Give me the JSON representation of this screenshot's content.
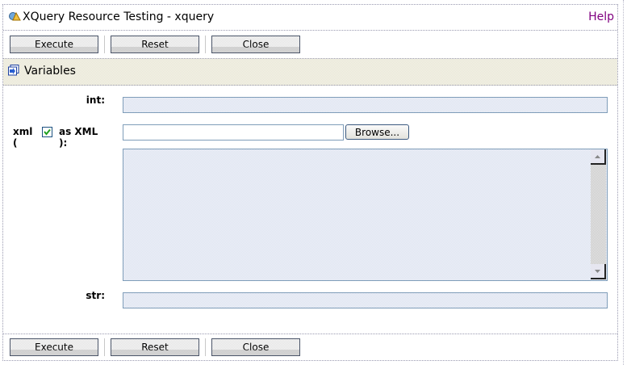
{
  "header": {
    "title": "XQuery Resource Testing - xquery",
    "help_label": "Help"
  },
  "toolbar": {
    "execute_label": "Execute",
    "reset_label": "Reset",
    "close_label": "Close"
  },
  "variables": {
    "section_title": "Variables",
    "int": {
      "label": "int:",
      "value": ""
    },
    "xml": {
      "label_prefix": "xml (",
      "checkbox_label": "as XML ):",
      "as_xml_checked": true,
      "file_value": "",
      "browse_label": "Browse...",
      "text_value": ""
    },
    "str": {
      "label": "str:",
      "value": ""
    }
  },
  "colors": {
    "help_link": "#800080",
    "field_border": "#7f9db9"
  }
}
